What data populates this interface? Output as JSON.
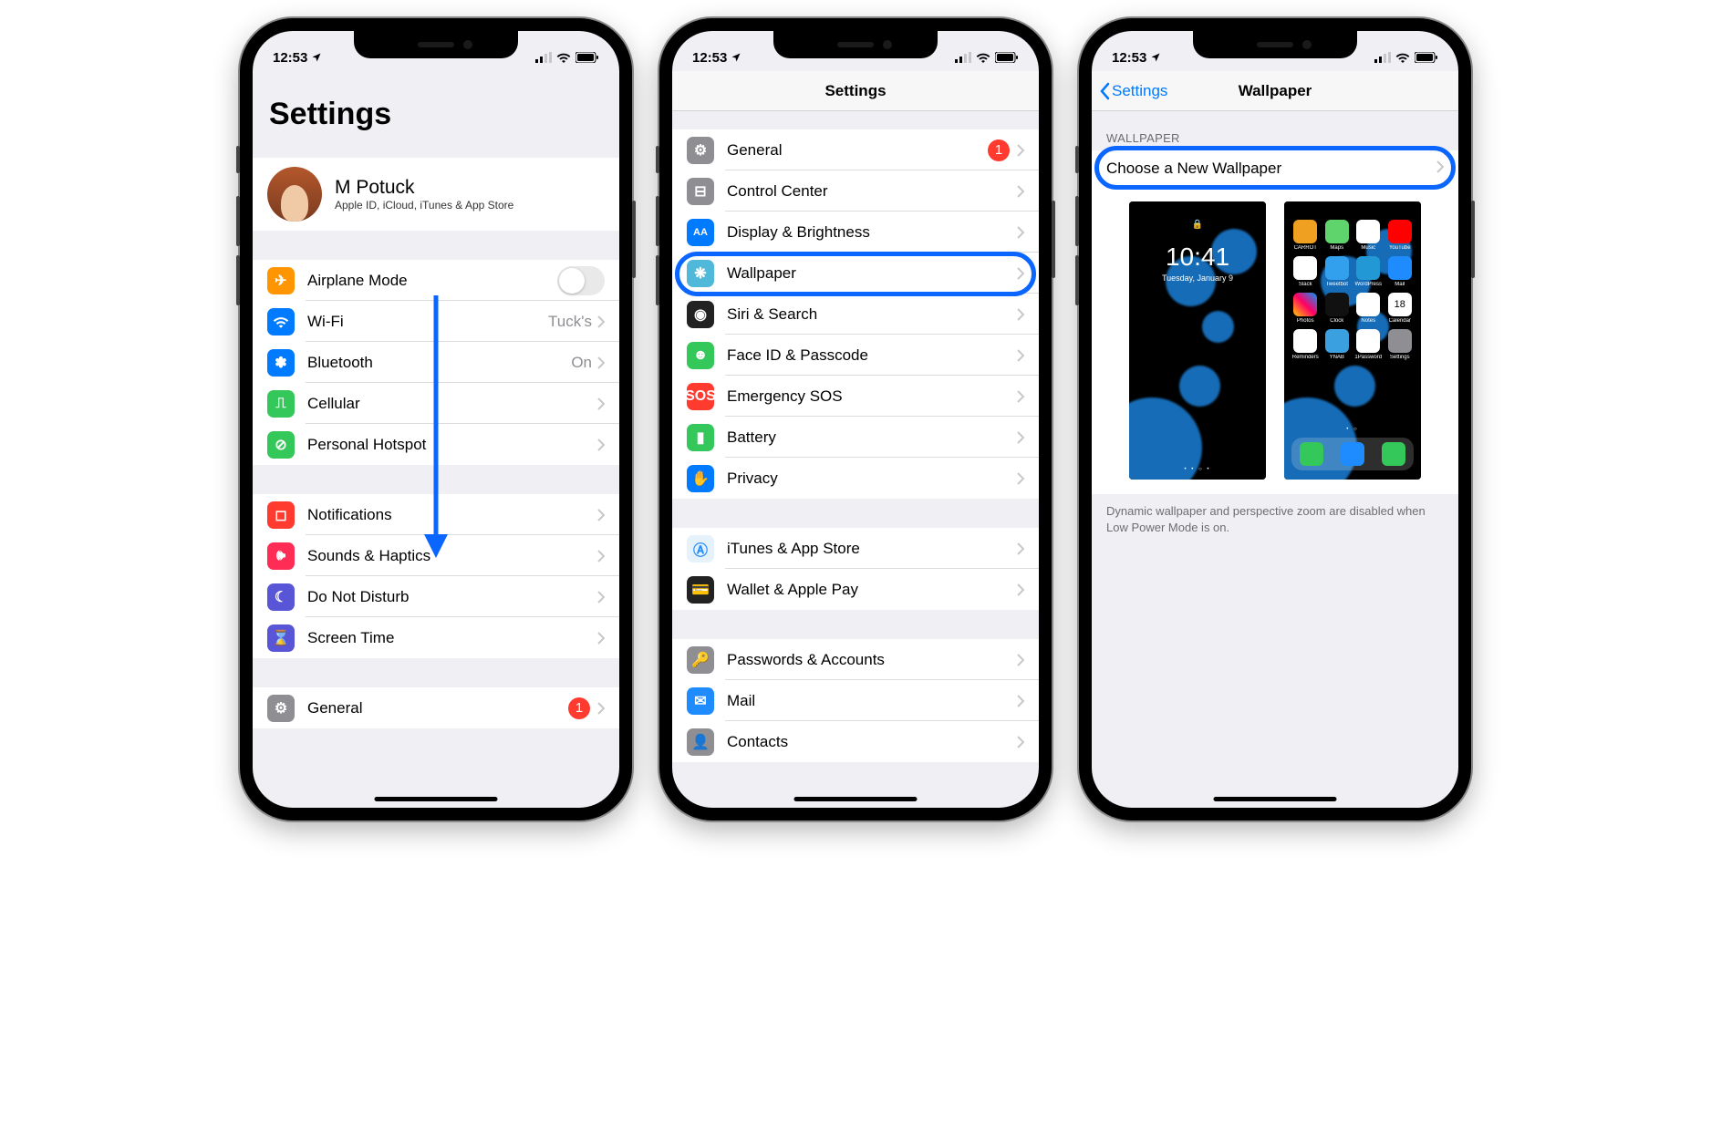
{
  "status": {
    "time": "12:53",
    "location_arrow": "↗"
  },
  "screen1": {
    "title": "Settings",
    "profile": {
      "name": "M Potuck",
      "subtitle": "Apple ID, iCloud, iTunes & App Store"
    },
    "groupA": [
      {
        "label": "Airplane Mode",
        "type": "toggle"
      },
      {
        "label": "Wi-Fi",
        "value": "Tuck's"
      },
      {
        "label": "Bluetooth",
        "value": "On"
      },
      {
        "label": "Cellular"
      },
      {
        "label": "Personal Hotspot"
      }
    ],
    "groupB": [
      {
        "label": "Notifications"
      },
      {
        "label": "Sounds & Haptics"
      },
      {
        "label": "Do Not Disturb"
      },
      {
        "label": "Screen Time"
      }
    ],
    "groupC": [
      {
        "label": "General",
        "badge": "1"
      }
    ]
  },
  "screen2": {
    "title": "Settings",
    "groupA": [
      {
        "label": "General",
        "badge": "1"
      },
      {
        "label": "Control Center"
      },
      {
        "label": "Display & Brightness"
      },
      {
        "label": "Wallpaper",
        "highlighted": true
      },
      {
        "label": "Siri & Search"
      },
      {
        "label": "Face ID & Passcode"
      },
      {
        "label": "Emergency SOS"
      },
      {
        "label": "Battery"
      },
      {
        "label": "Privacy"
      }
    ],
    "groupB": [
      {
        "label": "iTunes & App Store"
      },
      {
        "label": "Wallet & Apple Pay"
      }
    ],
    "groupC": [
      {
        "label": "Passwords & Accounts"
      },
      {
        "label": "Mail"
      },
      {
        "label": "Contacts"
      }
    ]
  },
  "screen3": {
    "back": "Settings",
    "title": "Wallpaper",
    "section_header": "WALLPAPER",
    "choose": "Choose a New Wallpaper",
    "lock_preview": {
      "time": "10:41",
      "date": "Tuesday, January 9"
    },
    "home_apps_row1": [
      "CARROT",
      "Maps",
      "Music",
      "YouTube"
    ],
    "home_apps_row2": [
      "Slack",
      "Tweetbot",
      "WordPress",
      "Mail"
    ],
    "home_apps_row3": [
      "Photos",
      "Clock",
      "Notes",
      "Calendar"
    ],
    "home_apps_row4": [
      "Reminders",
      "YNAB",
      "1Password",
      "Settings"
    ],
    "home_apps_cal": "18",
    "footnote": "Dynamic wallpaper and perspective zoom are disabled when Low Power Mode is on."
  }
}
